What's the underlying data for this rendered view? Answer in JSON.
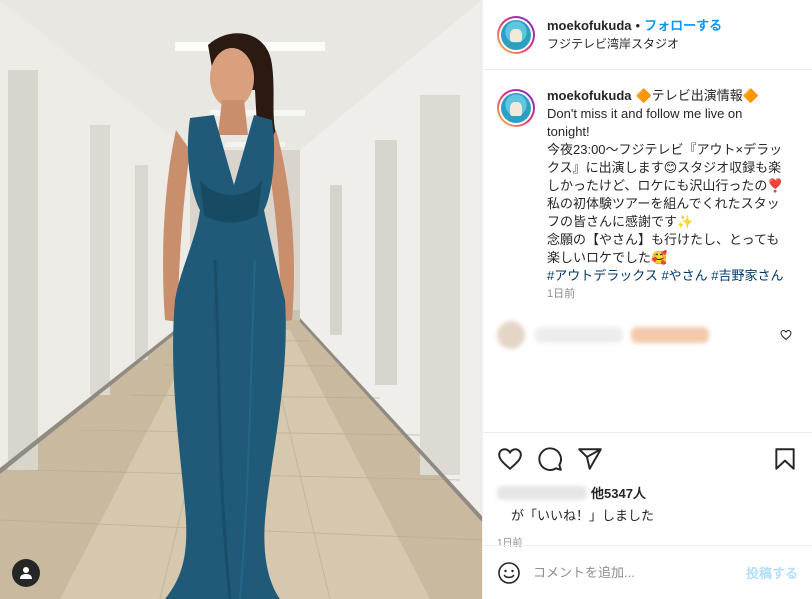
{
  "header": {
    "username": "moekofukuda",
    "separator": "•",
    "follow_label": "フォローする",
    "location": "フジテレビ湾岸スタジオ"
  },
  "caption": {
    "username": "moekofukuda",
    "title": "🔶テレビ出演情報🔶",
    "line1": "Don't miss it and follow me live on tonight!",
    "line2": "今夜23:00〜フジテレビ『アウト×デラックス』に出演します😊スタジオ収録も楽しかったけど、ロケにも沢山行ったの❣️",
    "line3": "私の初体験ツアーを組んでくれたスタッフの皆さんに感謝です✨",
    "line4": "念願の【やさん】も行けたし、とっても楽しいロケでした🥰",
    "hashtags": "#アウトデラックス #やさん #吉野家さん",
    "time": "1日前"
  },
  "likes": {
    "count": "他5347人",
    "suffix": "が「いいね！」しました"
  },
  "post_time": "1日前",
  "comment_box": {
    "placeholder": "コメントを追加...",
    "post_label": "投稿する"
  },
  "icons": {
    "like": "heart-icon",
    "comment": "comment-icon",
    "share": "share-icon",
    "save": "bookmark-icon",
    "emoji": "emoji-icon",
    "user_tag": "user-icon"
  },
  "colors": {
    "follow_blue": "#0095f6",
    "hashtag_blue": "#00376b",
    "post_disabled": "#b2dffc"
  }
}
